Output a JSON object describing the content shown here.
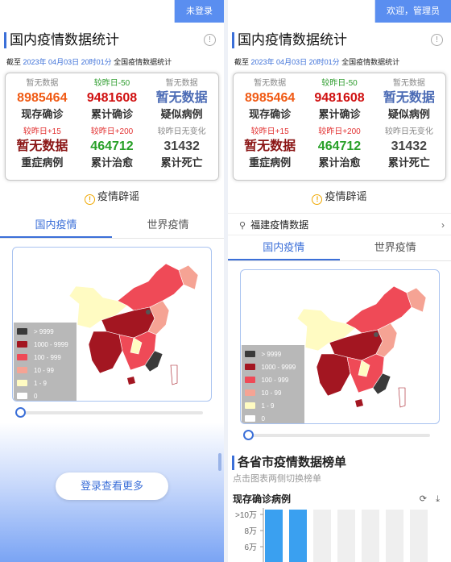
{
  "colors": {
    "accent": "#3b6fd8",
    "topbar": "#5a8ef0",
    "c_gt9999": "#3a3a3a",
    "c_1000": "#a31621",
    "c_100": "#ef4a57",
    "c_10": "#f5a394",
    "c_1": "#fffbc2",
    "c_0": "#ffffff"
  },
  "left": {
    "topbar_label": "未登录",
    "title": "国内疫情数据统计",
    "date_prefix": "截至",
    "date": "2023年 04月03日 20时01分",
    "date_suffix": "全国疫情数据统计",
    "stats": [
      {
        "sub": "暂无数据",
        "num": "8985464",
        "label": "现存确诊",
        "color": "#f05a14"
      },
      {
        "sub": "较昨日-50",
        "num": "9481608",
        "label": "累计确诊",
        "color": "#d01010",
        "sub_color": "#2e9d2e"
      },
      {
        "sub": "暂无数据",
        "num": "暂无数据",
        "label": "疑似病例",
        "color": "#4b6bb5"
      },
      {
        "sub": "较昨日+15",
        "num": "暂无数据",
        "label": "重症病例",
        "color": "#8b1515",
        "sub_color": "#e23030"
      },
      {
        "sub": "较昨日+200",
        "num": "464712",
        "label": "累计治愈",
        "color": "#28a028",
        "sub_color": "#e23030"
      },
      {
        "sub": "较昨日无变化",
        "num": "31432",
        "label": "累计死亡",
        "color": "#444444"
      }
    ],
    "rumor": "疫情辟谣",
    "tabs": [
      "国内疫情",
      "世界疫情"
    ],
    "legend": [
      "> 9999",
      "1000 - 9999",
      "100 - 999",
      "10 - 99",
      "1 - 9",
      "0"
    ],
    "login_button": "登录查看更多"
  },
  "right": {
    "topbar_label": "欢迎，管理员",
    "title": "国内疫情数据统计",
    "date_prefix": "截至",
    "date": "2023年 04月03日 20时01分",
    "date_suffix": "全国疫情数据统计",
    "rumor": "疫情辟谣",
    "province": "福建疫情数据",
    "tabs": [
      "国内疫情",
      "世界疫情"
    ],
    "legend": [
      "> 9999",
      "1000 - 9999",
      "100 - 999",
      "10 - 99",
      "1 - 9",
      "0"
    ],
    "rank_title": "各省市疫情数据榜单",
    "rank_hint": "点击图表两侧切换榜单",
    "chart_title": "现存确诊病例"
  },
  "chart_data": {
    "type": "bar",
    "title": "现存确诊病例",
    "yticks": [
      ">10万",
      "8万",
      "6万"
    ],
    "values": [
      100000,
      100000
    ],
    "note": "Only the top of the bar chart is visible; first two bars reach top, rest are grey background bars."
  }
}
